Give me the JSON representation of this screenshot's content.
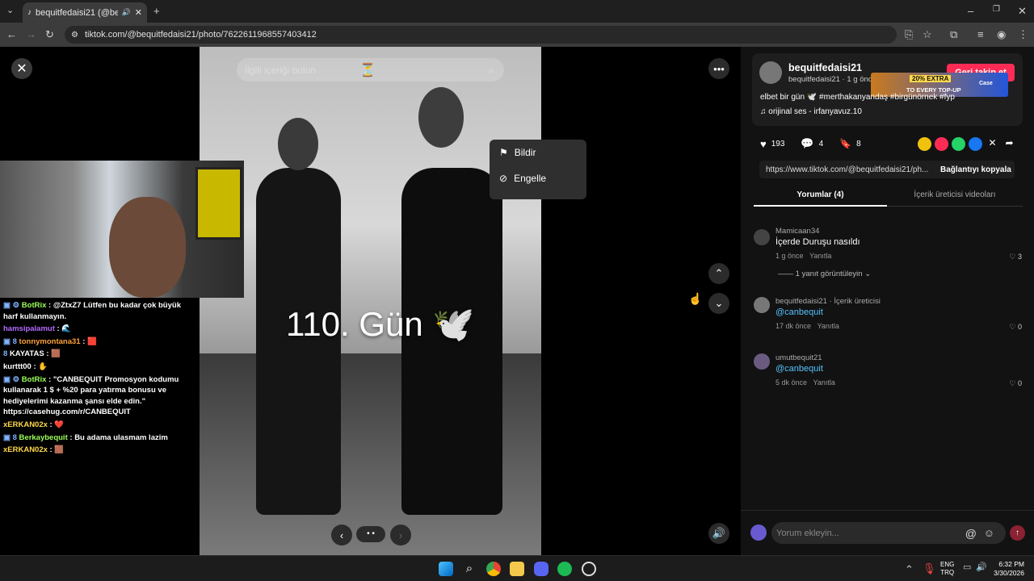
{
  "browser": {
    "tab_title": "bequitfedaisi21 (@bequitfe",
    "url": "tiktok.com/@bequitfedaisi21/photo/7622611968557403412"
  },
  "viewer": {
    "search_placeholder": "İlgili içeriği bulun",
    "overlay_text": "110. Gün 🕊️",
    "menu": {
      "report": "Bildir",
      "block": "Engelle"
    }
  },
  "chat": [
    {
      "user": "BotRix",
      "msg": "@ZtxZ7 Lütfen bu kadar çok büyük harf kullanmayın.",
      "ucolor": "#9bff5a",
      "badge": "▣ ⚙"
    },
    {
      "user": "hamsipalamut",
      "msg": "🌊",
      "ucolor": "#b36bff",
      "badge": ""
    },
    {
      "user": "tonnymontana31",
      "msg": "🟥",
      "ucolor": "#ffa23a",
      "badge": "▣ 8"
    },
    {
      "user": "KAYATAS",
      "msg": "🟫",
      "ucolor": "#ffffff",
      "badge": "8"
    },
    {
      "user": "kurttt00",
      "msg": "✋",
      "ucolor": "#ffffff",
      "badge": ""
    },
    {
      "user": "BotRix",
      "msg": "\"CANBEQUIT Promosyon kodumu kullanarak 1 $ + %20 para yatırma bonusu ve hediyelerimi kazanma şansı elde edin.\" https://casehug.com/r/CANBEQUIT",
      "ucolor": "#9bff5a",
      "badge": "▣ ⚙"
    },
    {
      "user": "xERKAN02x",
      "msg": "❤️",
      "ucolor": "#ffd84a",
      "badge": ""
    },
    {
      "user": "Berkaybequit",
      "msg": "Bu adama ulasmam lazim",
      "ucolor": "#9bff5a",
      "badge": "▣ 8"
    },
    {
      "user": "xERKAN02x",
      "msg": "🟫",
      "ucolor": "#ffd84a",
      "badge": ""
    }
  ],
  "post": {
    "author": "bequitfedaisi21",
    "sub": "bequitfedaisi21 · 1 g önce",
    "follow_label": "Geri takip et",
    "caption": "elbet bir gün 🕊️ #merthakanyandaş #birgünörnek #fyp",
    "sound": "orijinal ses - irfanyavuz.10",
    "likes": "193",
    "comments": "4",
    "saves": "8",
    "link": "https://www.tiktok.com/@bequitfedaisi21/ph...",
    "copy_label": "Bağlantıyı kopyala",
    "ad": {
      "line1": "20% EXTRA",
      "line2": "TO EVERY TOP-UP",
      "brand": "Case"
    }
  },
  "tabs": {
    "comments": "Yorumlar (4)",
    "creator": "İçerik üreticisi videoları"
  },
  "comments": [
    {
      "name": "Mamicaan34",
      "text": "İçerde Duruşu nasıldı",
      "time": "1 g önce",
      "reply": "Yanıtla",
      "likes": "3",
      "more": "1 yanıt görüntüleyin"
    },
    {
      "name": "bequitfedaisi21 · İçerik üreticisi",
      "text": "@canbequit",
      "time": "17 dk önce",
      "reply": "Yanıtla",
      "likes": "0"
    },
    {
      "name": "umutbequit21",
      "text": "@canbequit",
      "time": "5 dk önce",
      "reply": "Yanıtla",
      "likes": "0"
    }
  ],
  "comment_input_placeholder": "Yorum ekleyin...",
  "taskbar": {
    "lang1": "ENG",
    "lang2": "TRQ",
    "time": "6:32 PM",
    "date": "3/30/2026"
  }
}
